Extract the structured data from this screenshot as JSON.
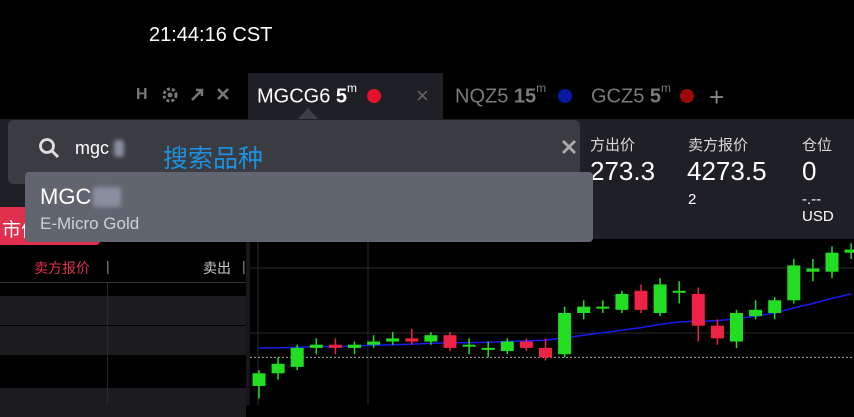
{
  "clock": "21:44:16 CST",
  "mini_toolbar": {
    "h_label": "H"
  },
  "tabs": [
    {
      "symbol": "MGCG6",
      "interval": "5",
      "unit": "m",
      "dot_color": "#e8102a",
      "active": true
    },
    {
      "symbol": "NQZ5",
      "interval": "15",
      "unit": "m",
      "dot_color": "#0a1aa0",
      "active": false
    },
    {
      "symbol": "GCZ5",
      "interval": "5",
      "unit": "m",
      "dot_color": "#9a0a0a",
      "active": false
    }
  ],
  "add_tab": "+",
  "quote": {
    "sell_label_partial": "方出价",
    "sell_value_partial": "273.3",
    "ask_label": "卖方报价",
    "ask_value": "4273.5",
    "ask_size": "2",
    "position_label": "仓位",
    "position_value": "0",
    "position_sub": "-.-- USD"
  },
  "market_sell_btn": "市价",
  "table_headers": {
    "ask": "卖方报价",
    "sell": "卖出"
  },
  "search": {
    "query": "mgc",
    "annotation": "搜索品种",
    "result_code": "MGC",
    "result_desc": "E-Micro Gold"
  },
  "colors": {
    "up": "#22dd22",
    "down": "#ee2244",
    "ma": "#1a1aee",
    "accent": "#1e90e0"
  },
  "chart_data": {
    "type": "candlestick",
    "candles": [
      {
        "o": 4251.0,
        "h": 4253.5,
        "l": 4249.0,
        "c": 4253.0
      },
      {
        "o": 4253.0,
        "h": 4255.5,
        "l": 4252.0,
        "c": 4254.5
      },
      {
        "o": 4254.0,
        "h": 4257.5,
        "l": 4253.5,
        "c": 4257.0
      },
      {
        "o": 4257.0,
        "h": 4258.5,
        "l": 4256.0,
        "c": 4257.5
      },
      {
        "o": 4257.5,
        "h": 4258.5,
        "l": 4256.0,
        "c": 4257.0
      },
      {
        "o": 4257.0,
        "h": 4258.0,
        "l": 4256.0,
        "c": 4257.5
      },
      {
        "o": 4257.5,
        "h": 4259.0,
        "l": 4257.0,
        "c": 4258.0
      },
      {
        "o": 4258.0,
        "h": 4259.5,
        "l": 4257.5,
        "c": 4258.5
      },
      {
        "o": 4258.5,
        "h": 4260.0,
        "l": 4257.5,
        "c": 4258.0
      },
      {
        "o": 4258.0,
        "h": 4259.5,
        "l": 4257.5,
        "c": 4259.0
      },
      {
        "o": 4259.0,
        "h": 4259.5,
        "l": 4256.5,
        "c": 4257.0
      },
      {
        "o": 4257.5,
        "h": 4258.5,
        "l": 4256.0,
        "c": 4257.5
      },
      {
        "o": 4257.0,
        "h": 4258.0,
        "l": 4255.5,
        "c": 4257.0
      },
      {
        "o": 4256.5,
        "h": 4258.5,
        "l": 4256.0,
        "c": 4258.0
      },
      {
        "o": 4258.0,
        "h": 4258.5,
        "l": 4256.5,
        "c": 4257.0
      },
      {
        "o": 4257.0,
        "h": 4258.5,
        "l": 4255.0,
        "c": 4255.5
      },
      {
        "o": 4256.0,
        "h": 4263.5,
        "l": 4255.5,
        "c": 4262.5
      },
      {
        "o": 4262.5,
        "h": 4264.5,
        "l": 4261.5,
        "c": 4263.5
      },
      {
        "o": 4263.5,
        "h": 4264.5,
        "l": 4262.5,
        "c": 4263.5
      },
      {
        "o": 4263.0,
        "h": 4266.0,
        "l": 4262.5,
        "c": 4265.5
      },
      {
        "o": 4266.0,
        "h": 4267.0,
        "l": 4262.5,
        "c": 4263.0
      },
      {
        "o": 4262.5,
        "h": 4268.0,
        "l": 4262.0,
        "c": 4267.0
      },
      {
        "o": 4266.0,
        "h": 4267.5,
        "l": 4264.0,
        "c": 4266.0
      },
      {
        "o": 4265.5,
        "h": 4266.5,
        "l": 4258.0,
        "c": 4260.5
      },
      {
        "o": 4260.5,
        "h": 4261.5,
        "l": 4257.5,
        "c": 4258.5
      },
      {
        "o": 4258.0,
        "h": 4263.0,
        "l": 4257.0,
        "c": 4262.5
      },
      {
        "o": 4262.0,
        "h": 4264.5,
        "l": 4261.5,
        "c": 4263.0
      },
      {
        "o": 4262.5,
        "h": 4265.0,
        "l": 4261.5,
        "c": 4264.5
      },
      {
        "o": 4264.5,
        "h": 4271.0,
        "l": 4264.0,
        "c": 4270.0
      },
      {
        "o": 4269.0,
        "h": 4271.0,
        "l": 4267.5,
        "c": 4269.5
      },
      {
        "o": 4269.0,
        "h": 4273.0,
        "l": 4268.0,
        "c": 4272.0
      },
      {
        "o": 4272.0,
        "h": 4273.5,
        "l": 4271.0,
        "c": 4272.5
      }
    ],
    "ma": [
      4257.0,
      4257.0,
      4257.1,
      4257.2,
      4257.2,
      4257.3,
      4257.4,
      4257.5,
      4257.6,
      4257.7,
      4257.8,
      4257.8,
      4257.9,
      4258.0,
      4258.1,
      4258.2,
      4258.6,
      4259.0,
      4259.4,
      4259.8,
      4260.2,
      4260.7,
      4261.1,
      4261.2,
      4261.3,
      4261.6,
      4262.0,
      4262.5,
      4263.3,
      4264.0,
      4264.8,
      4265.5
    ],
    "price_line": 4255.5,
    "ylim": [
      4248,
      4274
    ]
  }
}
